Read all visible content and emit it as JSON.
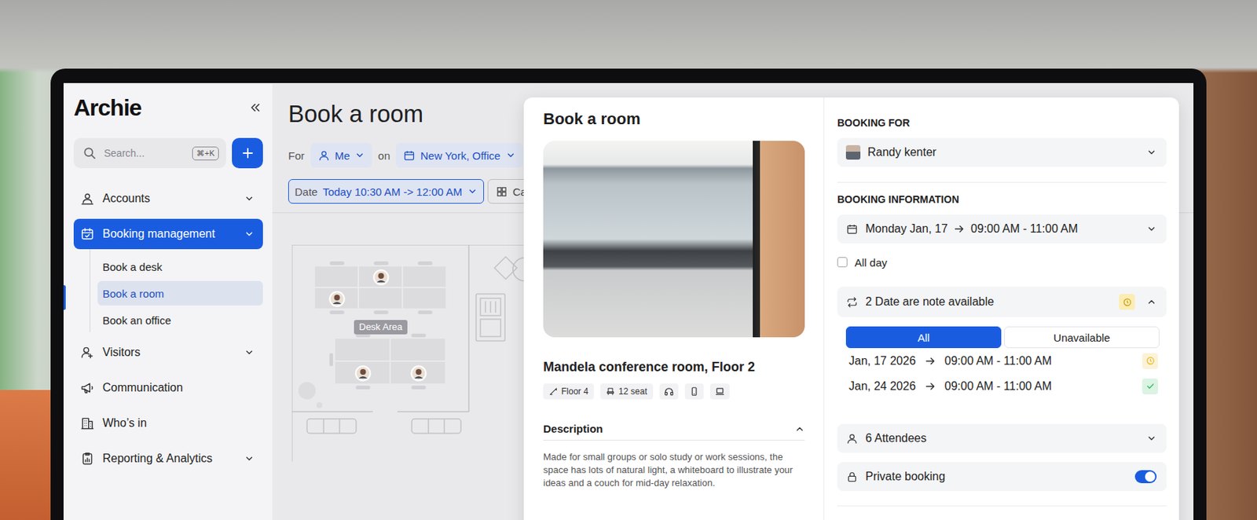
{
  "app": {
    "logo": "Archie"
  },
  "search": {
    "placeholder": "Search...",
    "shortcut": "⌘+K"
  },
  "sidebar": {
    "items": [
      {
        "label": "Accounts",
        "expandable": true,
        "expanded": false,
        "selected": false,
        "children": []
      },
      {
        "label": "Booking management",
        "expandable": true,
        "expanded": true,
        "selected": true,
        "children": [
          {
            "label": "Book a desk",
            "selected": false
          },
          {
            "label": "Book a room",
            "selected": true
          },
          {
            "label": "Book an office",
            "selected": false
          }
        ]
      },
      {
        "label": "Visitors",
        "expandable": true,
        "expanded": false,
        "selected": false,
        "children": []
      },
      {
        "label": "Communication",
        "expandable": false,
        "expanded": false,
        "selected": false,
        "children": []
      },
      {
        "label": "Who’s in",
        "expandable": false,
        "expanded": false,
        "selected": false,
        "children": []
      },
      {
        "label": "Reporting & Analytics",
        "expandable": true,
        "expanded": false,
        "selected": false,
        "children": []
      }
    ]
  },
  "page": {
    "title": "Book a room",
    "filters": {
      "for_label": "For",
      "for_value": "Me",
      "on_label": "on",
      "location": "New York, Office",
      "date_label": "Date",
      "date_value": "Today 10:30 AM -> 12:00 AM",
      "category": "Ca"
    }
  },
  "floor_plan": {
    "area_label": "Desk Area",
    "tables": [
      {
        "columns": 3,
        "desks": [
          {
            "occupied": false
          },
          {
            "occupied": true
          },
          {
            "occupied": false
          },
          {
            "occupied": true
          },
          {
            "occupied": false
          },
          {
            "occupied": false
          }
        ]
      },
      {
        "columns": 2,
        "desks": [
          {
            "occupied": false
          },
          {
            "occupied": false
          },
          {
            "occupied": true
          },
          {
            "occupied": true
          }
        ]
      }
    ]
  },
  "modal": {
    "title": "Book a room",
    "room": {
      "name": "Mandela conference room, Floor 2",
      "tags": [
        "Floor 4",
        "12 seat"
      ]
    },
    "description": {
      "title": "Description",
      "expanded": true,
      "text": "Made for small groups or solo study or work sessions, the space has lots of natural light, a whiteboard to illustrate your ideas and a couch for mid-day relaxation."
    }
  },
  "booking": {
    "for_heading": "BOOKING FOR",
    "person": "Randy kenter",
    "info_heading": "BOOKING INFORMATION",
    "date": "Monday Jan, 17",
    "time": "09:00 AM - 11:00 AM",
    "all_day": {
      "label": "All day",
      "checked": false
    },
    "availability": {
      "label": "2 Date are note available",
      "expanded": true,
      "filters": [
        {
          "label": "All",
          "selected": true
        },
        {
          "label": "Unavailable",
          "selected": false
        }
      ],
      "dates": [
        {
          "date": "Jan, 17 2026",
          "time": "09:00 AM - 11:00 AM",
          "available": false,
          "color": "#e9b821"
        },
        {
          "date": "Jan, 24 2026",
          "time": "09:00 AM - 11:00 AM",
          "available": true,
          "color": "#3cbf6a"
        }
      ]
    },
    "attendees": "6 Attendees",
    "private_booking": {
      "label": "Private booking",
      "on": true
    }
  }
}
